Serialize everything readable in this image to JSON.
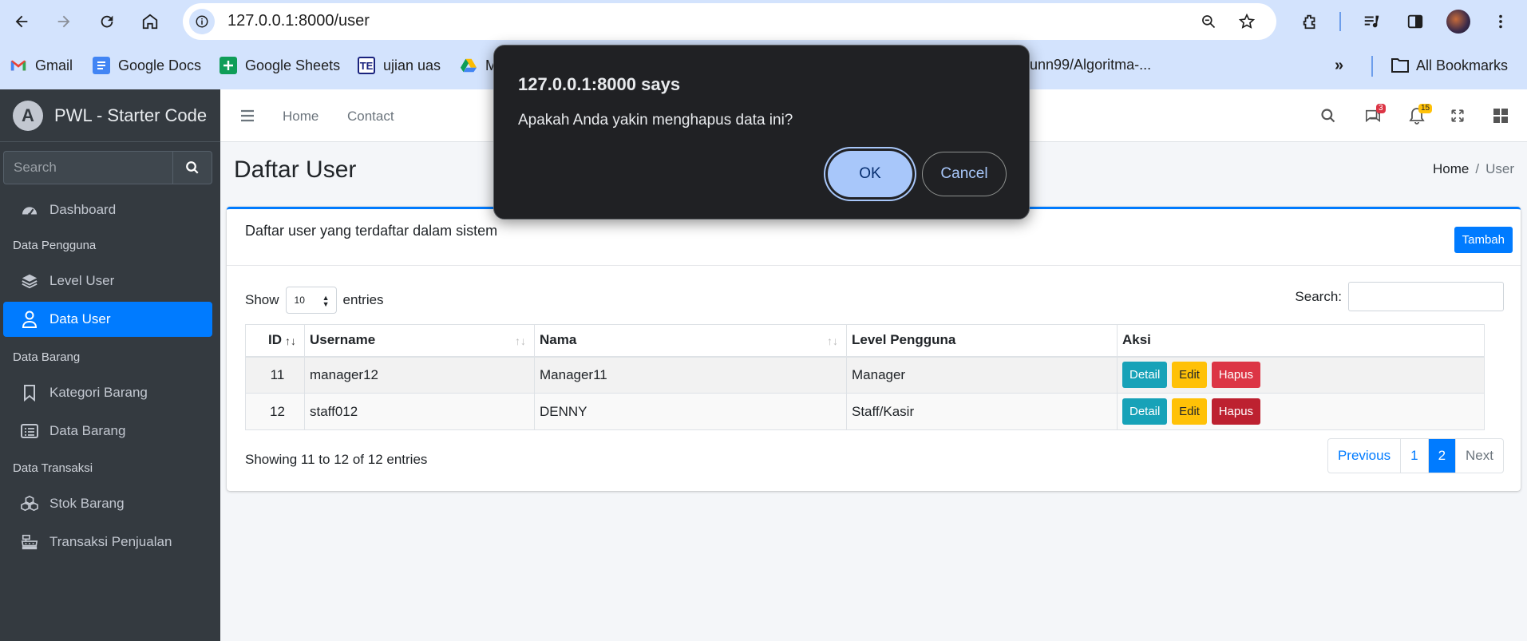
{
  "browser": {
    "url": "127.0.0.1:8000/user",
    "bookmarks": [
      "Gmail",
      "Google Docs",
      "Google Sheets",
      "ujian uas",
      "M",
      "unn99/Algoritma-..."
    ],
    "all_bookmarks_label": "All Bookmarks"
  },
  "dialog": {
    "title": "127.0.0.1:8000 says",
    "message": "Apakah Anda yakin menghapus data ini?",
    "ok_label": "OK",
    "cancel_label": "Cancel"
  },
  "sidebar": {
    "brand": "PWL - Starter Code",
    "search_placeholder": "Search",
    "dashboard": "Dashboard",
    "header_pengguna": "Data Pengguna",
    "level_user": "Level User",
    "data_user": "Data User",
    "header_barang": "Data Barang",
    "kategori_barang": "Kategori Barang",
    "data_barang": "Data Barang",
    "header_transaksi": "Data Transaksi",
    "stok_barang": "Stok Barang",
    "transaksi_penjualan": "Transaksi Penjualan"
  },
  "topnav": {
    "home": "Home",
    "contact": "Contact",
    "messages_count": "3",
    "notifications_count": "15"
  },
  "page": {
    "title": "Daftar User",
    "breadcrumb_home": "Home",
    "breadcrumb_sep": "/",
    "breadcrumb_current": "User"
  },
  "card": {
    "title": "Daftar user yang terdaftar dalam sistem",
    "add_label": "Tambah",
    "show_label": "Show",
    "entries_label": "entries",
    "page_length": "10",
    "search_label": "Search:",
    "info": "Showing 11 to 12 of 12 entries",
    "previous": "Previous",
    "next": "Next",
    "pages": [
      "1",
      "2"
    ]
  },
  "table": {
    "headers": [
      "ID",
      "Username",
      "Nama",
      "Level Pengguna",
      "Aksi"
    ],
    "rows": [
      {
        "id": "11",
        "username": "manager12",
        "nama": "Manager11",
        "level": "Manager"
      },
      {
        "id": "12",
        "username": "staff012",
        "nama": "DENNY",
        "level": "Staff/Kasir"
      }
    ],
    "btn_detail": "Detail",
    "btn_edit": "Edit",
    "btn_hapus": "Hapus"
  },
  "colors": {
    "primary": "#007bff",
    "sidebar": "#343a40",
    "danger": "#dc3545",
    "warning": "#ffc107",
    "info": "#17a2b8"
  }
}
